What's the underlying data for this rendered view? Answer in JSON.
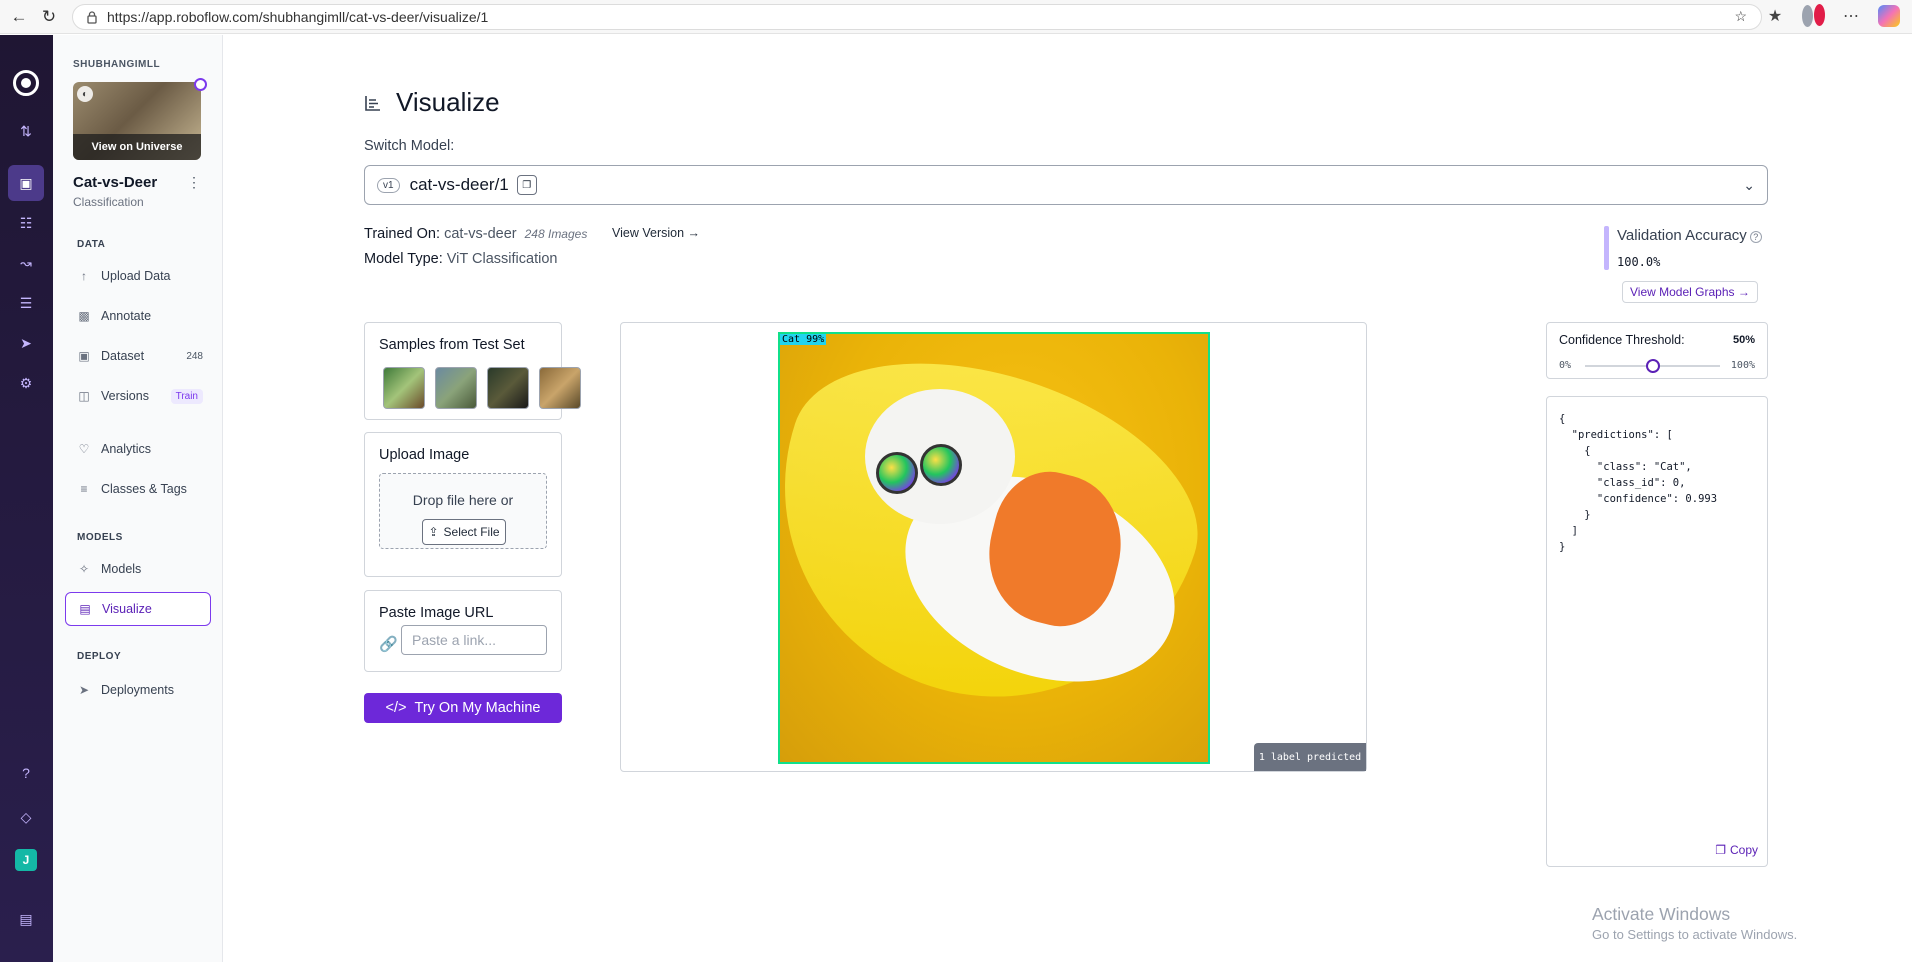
{
  "browser": {
    "url": "https://app.roboflow.com/shubhangimll/cat-vs-deer/visualize/1"
  },
  "rail": {
    "user_initial": "J"
  },
  "sidebar": {
    "workspace": "SHUBHANGIMLL",
    "view_on_universe": "View on Universe",
    "project_name": "Cat-vs-Deer",
    "project_type": "Classification",
    "sections": {
      "data": "DATA",
      "models": "MODELS",
      "deploy": "DEPLOY"
    },
    "items": [
      {
        "label": "Upload Data",
        "icon": "upload-icon"
      },
      {
        "label": "Annotate",
        "icon": "annotate-icon"
      },
      {
        "label": "Dataset",
        "icon": "dataset-icon",
        "badge": "248"
      },
      {
        "label": "Versions",
        "icon": "versions-icon",
        "badge": "Train"
      },
      {
        "label": "Analytics",
        "icon": "analytics-icon"
      },
      {
        "label": "Classes & Tags",
        "icon": "classes-icon"
      },
      {
        "label": "Models",
        "icon": "models-icon"
      },
      {
        "label": "Visualize",
        "icon": "visualize-icon",
        "active": true
      },
      {
        "label": "Deployments",
        "icon": "deployments-icon"
      }
    ]
  },
  "main": {
    "title": "Visualize",
    "switch_model_label": "Switch Model:",
    "model_version_badge": "v1",
    "model_name": "cat-vs-deer/1",
    "trained_on_label": "Trained On:",
    "trained_on_value": "cat-vs-deer",
    "trained_on_images": "248 Images",
    "view_version": "View Version →",
    "model_type_label": "Model Type:",
    "model_type_value": "ViT Classification",
    "validation_accuracy_label": "Validation Accuracy",
    "validation_accuracy_value": "100.0%",
    "view_model_graphs": "View Model Graphs →",
    "samples_title": "Samples from Test Set",
    "upload_title": "Upload Image",
    "drop_text": "Drop file here or",
    "select_file": "Select File",
    "paste_url_title": "Paste Image URL",
    "paste_url_placeholder": "Paste a link...",
    "try_button": "Try On My Machine",
    "prediction_label": "Cat 99%",
    "labels_predicted": "1 label predicted",
    "confidence_label": "Confidence Threshold:",
    "confidence_value": "50%",
    "confidence_fraction": 0.5,
    "confidence_min": "0%",
    "confidence_max": "100%",
    "json_output": "{\n  \"predictions\": [\n    {\n      \"class\": \"Cat\",\n      \"class_id\": 0,\n      \"confidence\": 0.993\n    }\n  ]\n}",
    "copy_label": "Copy"
  },
  "watermark": {
    "line1": "Activate Windows",
    "line2": "Go to Settings to activate Windows."
  },
  "colors": {
    "accent": "#6d28d9",
    "rail_bg": "#1f1633",
    "prediction_box": "#10e08a",
    "prediction_label_bg": "#22d3ee"
  }
}
